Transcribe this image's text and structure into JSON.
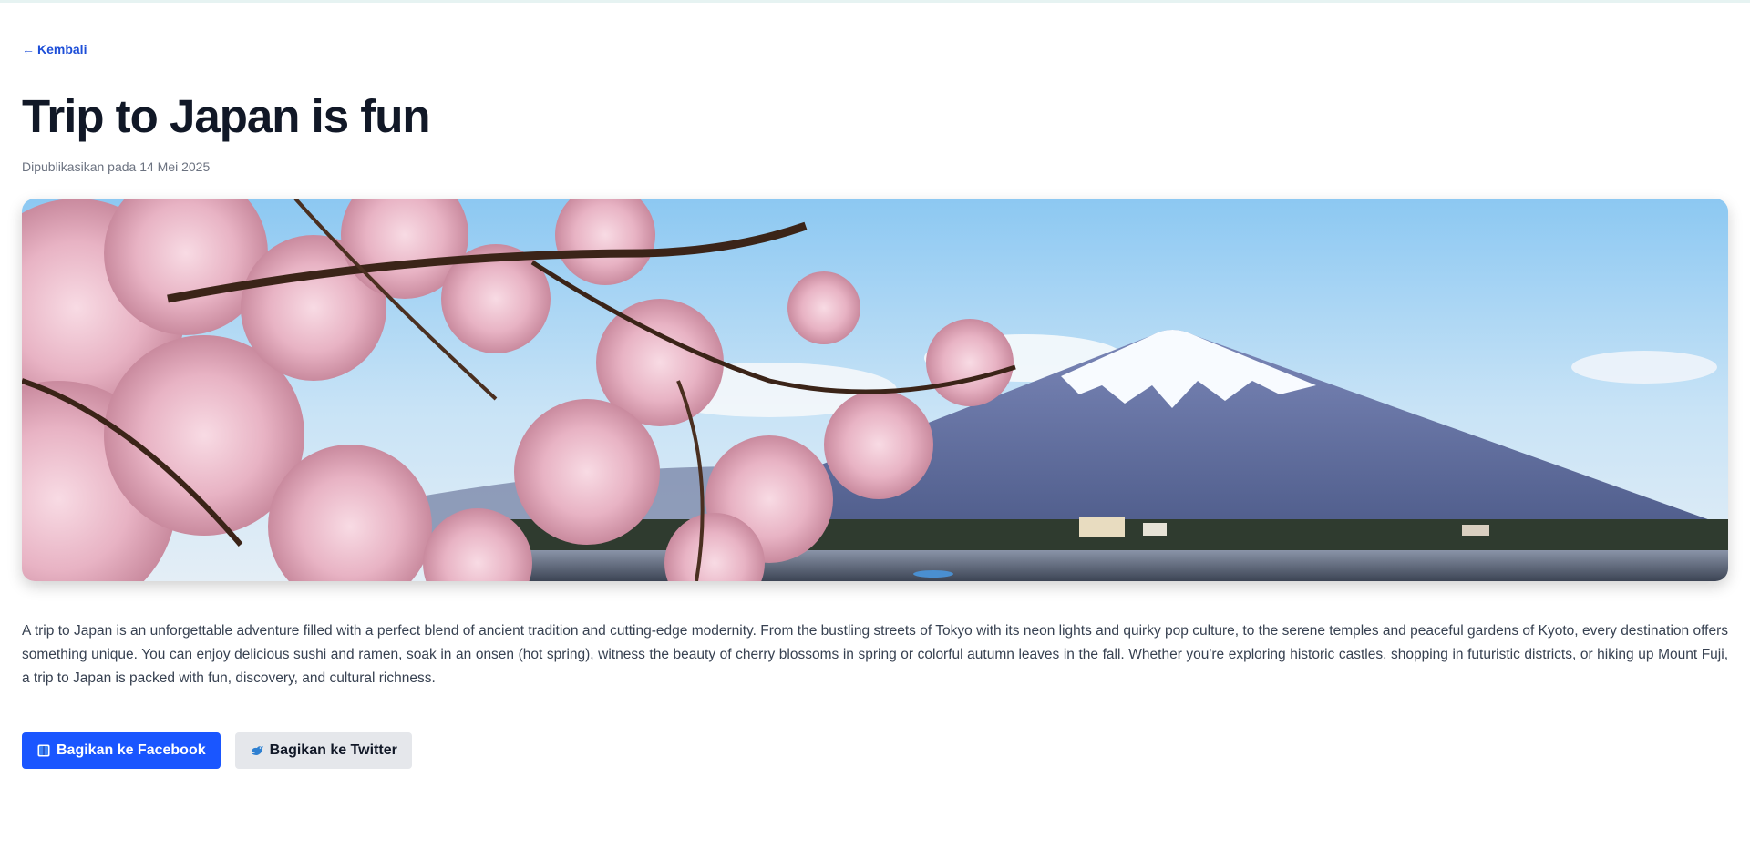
{
  "nav": {
    "back_label": "Kembali"
  },
  "article": {
    "title": "Trip to Japan is fun",
    "published": "Dipublikasikan pada 14 Mei 2025",
    "hero_image": "mount-fuji-cherry-blossom",
    "body": "A trip to Japan is an unforgettable adventure filled with a perfect blend of ancient tradition and cutting-edge modernity. From the bustling streets of Tokyo with its neon lights and quirky pop culture, to the serene temples and peaceful gardens of Kyoto, every destination offers something unique. You can enjoy delicious sushi and ramen, soak in an onsen (hot spring), witness the beauty of cherry blossoms in spring or colorful autumn leaves in the fall. Whether you're exploring historic castles, shopping in futuristic districts, or hiking up Mount Fuji, a trip to Japan is packed with fun, discovery, and cultural richness."
  },
  "share": {
    "facebook_label": "Bagikan ke Facebook",
    "twitter_label": "Bagikan ke Twitter",
    "facebook_icon": "book-icon",
    "twitter_icon": "bird-icon"
  },
  "colors": {
    "accent": "#1d4ed8",
    "facebook_button": "#1a56ff",
    "twitter_button": "#e5e7eb",
    "title": "#111827"
  }
}
